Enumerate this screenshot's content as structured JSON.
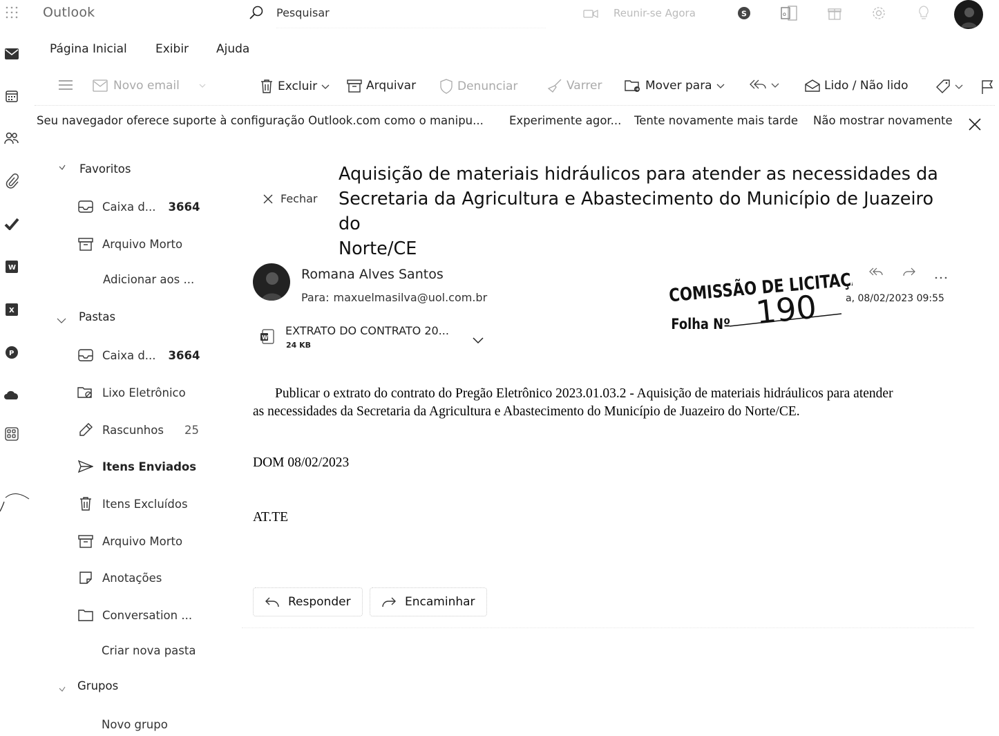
{
  "app": {
    "title": "Outlook",
    "search_placeholder": "Pesquisar",
    "meet_now": "Reunir-se Agora"
  },
  "ribbon": {
    "tabs": [
      "Página Inicial",
      "Exibir",
      "Ajuda"
    ]
  },
  "toolbar": {
    "new_email": "Novo email",
    "delete": "Excluir",
    "archive": "Arquivar",
    "report": "Denunciar",
    "sweep": "Varrer",
    "move_to": "Mover para",
    "read_unread": "Lido / Não lido"
  },
  "banner": {
    "message": "Seu navegador oferece suporte à configuração Outlook.com como o manipu...",
    "try_now": "Experimente agor...",
    "retry_later": "Tente novamente mais tarde",
    "dont_show": "Não mostrar novamente"
  },
  "sidebar": {
    "favorites_label": "Favoritos",
    "favorites": [
      {
        "label": "Caixa d...",
        "count": "3664"
      },
      {
        "label": "Arquivo Morto",
        "count": ""
      },
      {
        "label": "Adicionar aos ...",
        "count": ""
      }
    ],
    "folders_label": "Pastas",
    "folders": [
      {
        "label": "Caixa d...",
        "count": "3664"
      },
      {
        "label": "Lixo Eletrônico",
        "count": ""
      },
      {
        "label": "Rascunhos",
        "count": "25"
      },
      {
        "label": "Itens Enviados",
        "count": ""
      },
      {
        "label": "Itens Excluídos",
        "count": ""
      },
      {
        "label": "Arquivo Morto",
        "count": ""
      },
      {
        "label": "Anotações",
        "count": ""
      },
      {
        "label": "Conversation ...",
        "count": ""
      },
      {
        "label": "Criar nova pasta",
        "count": ""
      }
    ],
    "groups_label": "Grupos",
    "new_group": "Novo grupo"
  },
  "message": {
    "close_label": "Fechar",
    "subject_lines": [
      "Aquisição de materiais hidráulicos para atender as necessidades da",
      "Secretaria da Agricultura e Abastecimento do Município de Juazeiro do",
      "Norte/CE"
    ],
    "sender": "Romana Alves Santos",
    "to_label": "Para:",
    "to": "maxuelmasilva@uol.com.br",
    "date": "a, 08/02/2023 09:55",
    "attachment": {
      "name": "EXTRATO DO CONTRATO 20...",
      "size": "24 KB"
    },
    "body_lines": [
      "Publicar o extrato do contrato do Pregão Eletrônico 2023.01.03.2 - Aquisição de materiais hidráulicos para atender",
      "as necessidades da Secretaria da Agricultura e Abastecimento do Município de Juazeiro do Norte/CE."
    ],
    "body_dom": "DOM 08/02/2023",
    "body_signoff": "AT.TE",
    "reply": "Responder",
    "forward": "Encaminhar"
  },
  "stamp": {
    "title": "COMISSÃO DE LICITAÇÃO",
    "folha_label": "Folha Nº",
    "number": "190"
  },
  "icons": [
    "waffle-icon",
    "search-icon",
    "meet-icon",
    "skype-icon",
    "calendar-icon",
    "gift-icon",
    "settings-icon",
    "lightbulb-icon",
    "mail-icon",
    "people-icon",
    "paperclip-icon",
    "todo-icon",
    "word-icon",
    "excel-icon",
    "powerpoint-icon",
    "onedrive-icon",
    "apps-icon"
  ]
}
